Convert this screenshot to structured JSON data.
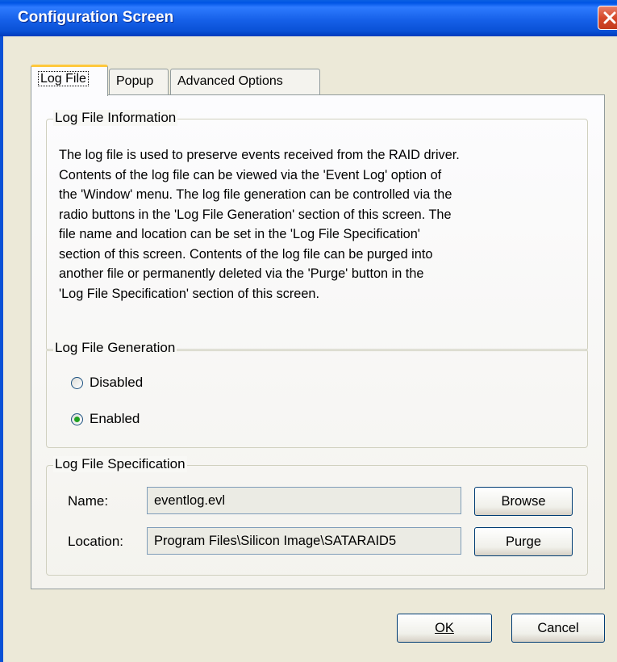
{
  "window": {
    "title": "Configuration Screen"
  },
  "tabs": [
    {
      "label": "Log File",
      "active": true
    },
    {
      "label": "Popup",
      "active": false
    },
    {
      "label": "Advanced Options",
      "active": false
    }
  ],
  "log_info": {
    "legend": "Log File Information",
    "lines": [
      "The log file is used to preserve events received from the RAID driver.",
      "Contents of the log file can be viewed via the 'Event Log' option of",
      "the 'Window' menu. The log file generation can be controlled via the",
      "radio buttons in the 'Log File Generation' section of this screen. The",
      "file name and location can be set  in  the  'Log File Specification'",
      "section of this screen.  Contents of the log file can be purged into",
      "another  file  or  permanently deleted via the 'Purge' button in the",
      "'Log File Specification' section of this screen."
    ]
  },
  "log_gen": {
    "legend": "Log File Generation",
    "options": [
      {
        "label": "Disabled",
        "checked": false
      },
      {
        "label": "Enabled",
        "checked": true
      }
    ]
  },
  "log_spec": {
    "legend": "Log File Specification",
    "name_label": "Name:",
    "name_value": "eventlog.evl",
    "location_label": "Location:",
    "location_value": "Program Files\\Silicon Image\\SATARAID5",
    "browse_label": "Browse",
    "purge_label": "Purge"
  },
  "footer": {
    "ok_label": "OK",
    "cancel_label": "Cancel"
  }
}
